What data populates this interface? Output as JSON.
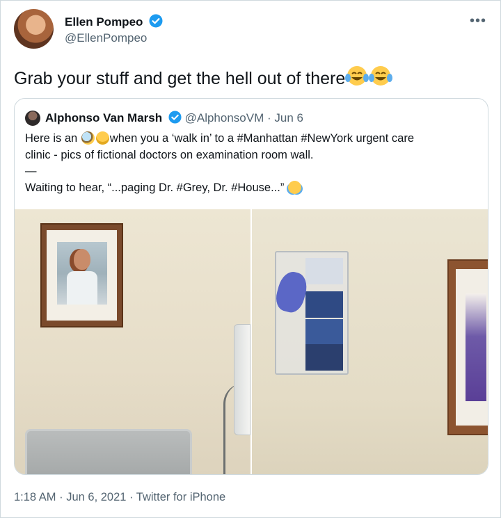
{
  "author": {
    "display_name": "Ellen Pompeo",
    "handle": "@EllenPompeo"
  },
  "tweet": {
    "text": "Grab your stuff and get the hell out of there"
  },
  "quoted": {
    "display_name": "Alphonso Van Marsh",
    "handle": "@AlphonsoVM",
    "date": "· Jun 6",
    "line1_a": "Here is an ",
    "line1_b": "when you a ‘walk in’ to a #Manhattan #NewYork urgent care",
    "line2": "clinic - pics of fictional doctors on examination room wall.",
    "line3": "—",
    "line4": "Waiting to hear, “...paging Dr. #Grey, Dr. #House...” "
  },
  "meta": {
    "timestamp": "1:18 AM · Jun 6, 2021 · Twitter for iPhone"
  },
  "icons": {
    "verified": "verified-badge-icon",
    "more": "more-options-icon",
    "emoji_tears_of_joy": "face-with-tears-of-joy",
    "emoji_magnifier": "magnifying-glass",
    "emoji_raised_eyebrow": "face-with-raised-eyebrow"
  },
  "colors": {
    "verified_blue": "#1d9bf0",
    "secondary_text": "#536471",
    "border": "#cfd9de"
  }
}
